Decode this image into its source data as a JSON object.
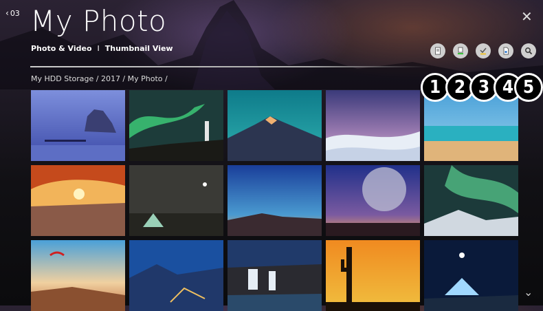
{
  "header": {
    "back_number": "03",
    "title": "My Photo",
    "subtitle_primary": "Photo & Video",
    "subtitle_separator": "I",
    "subtitle_view": "Thumbnail View"
  },
  "breadcrumb": "My HDD Storage / 2017 / My Photo /",
  "toolbar": {
    "buttons": [
      {
        "icon": "document-icon",
        "accent": "#ffffff"
      },
      {
        "icon": "delete-icon",
        "accent": "#3cc23c"
      },
      {
        "icon": "select-check-icon",
        "accent": "#f0c020"
      },
      {
        "icon": "file-info-icon",
        "accent": "#3a7fd0"
      },
      {
        "icon": "search-icon",
        "accent": "#333333"
      }
    ]
  },
  "callouts": [
    "1",
    "2",
    "3",
    "4",
    "5"
  ],
  "thumbnails": [
    {
      "subject": "rock-island-pier-dusk"
    },
    {
      "subject": "aurora-lighthouse"
    },
    {
      "subject": "mountain-peak-teal-sky"
    },
    {
      "subject": "white-dunes-twilight"
    },
    {
      "subject": "tropical-beach"
    },
    {
      "subject": "desert-arch-sunrise"
    },
    {
      "subject": "tent-lake-night"
    },
    {
      "subject": "desert-mountains-blue-hour"
    },
    {
      "subject": "large-moon-horizon"
    },
    {
      "subject": "aurora-mountain-ridge"
    },
    {
      "subject": "paraglider-sunset-coast"
    },
    {
      "subject": "city-lights-valley"
    },
    {
      "subject": "waterfall-night-sky"
    },
    {
      "subject": "cactus-orange-sunset"
    },
    {
      "subject": "glowing-tent-moon"
    }
  ]
}
